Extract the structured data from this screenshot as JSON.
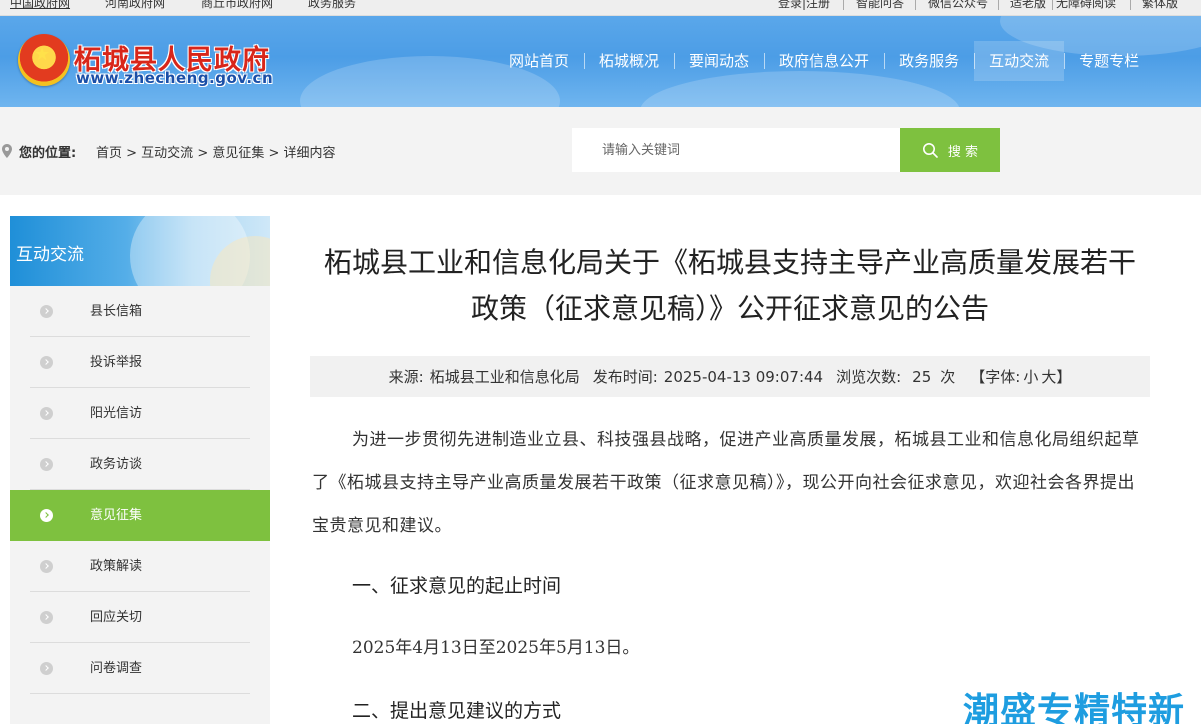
{
  "topbar": {
    "left_links": [
      "中国政府网",
      "河南政府网",
      "商丘市政府网",
      "政务服务"
    ],
    "right_links": [
      "登录|注册",
      "智能问答",
      "微信公众号",
      "适老版",
      "无障碍阅读",
      "繁体版"
    ]
  },
  "header": {
    "site_name": "柘城县人民政府",
    "site_url": "www.zhecheng.gov.cn",
    "nav": [
      "网站首页",
      "柘城概况",
      "要闻动态",
      "政府信息公开",
      "政务服务",
      "互动交流",
      "专题专栏"
    ],
    "active_nav": "互动交流",
    "colors": {
      "header_blue": "#4c9de6",
      "title_red": "#d8261a"
    }
  },
  "location": {
    "label": "您的位置:",
    "crumbs": [
      "首页",
      "> 互动交流",
      "> 意见征集",
      "> 详细内容"
    ]
  },
  "search": {
    "placeholder": "请输入关键词",
    "button_label": "搜 索",
    "button_color": "#7ec13f"
  },
  "sidebar": {
    "title": "互动交流",
    "items": [
      "县长信箱",
      "投诉举报",
      "阳光信访",
      "政务访谈",
      "意见征集",
      "政策解读",
      "回应关切",
      "问卷调查"
    ],
    "active_item": "意见征集",
    "active_color": "#7ec13f"
  },
  "article": {
    "title": "柘城县工业和信息化局关于《柘城县支持主导产业高质量发展若干政策（征求意见稿）》公开征求意见的公告",
    "meta": {
      "source_label": "来源:",
      "source": "柘城县工业和信息化局",
      "time_label": "发布时间:",
      "time": "2025-04-13 09:07:44",
      "views_label": "浏览次数:",
      "views": "25",
      "views_unit": "次",
      "font_label": "【字体:",
      "font_small": "小",
      "font_large": "大】"
    },
    "intro": "为进一步贯彻先进制造业立县、科技强县战略，促进产业高质量发展，柘城县工业和信息化局组织起草了《柘城县支持主导产业高质量发展若干政策（征求意见稿）》，现公开向社会征求意见，欢迎社会各界提出宝贵意见和建议。",
    "section1_heading": "一、征求意见的起止时间",
    "section1_text": "2025年4月13日至2025年5月13日。",
    "section2_heading": "二、提出意见建议的方式"
  },
  "watermark": "潮盛专精特新"
}
